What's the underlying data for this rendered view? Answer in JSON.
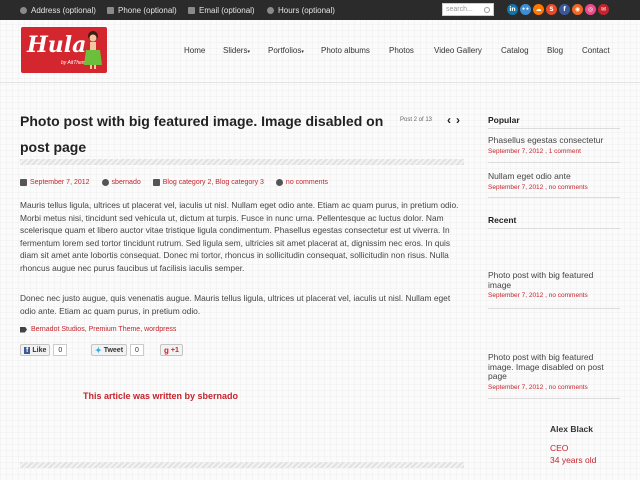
{
  "topbar": {
    "address": "Address (optional)",
    "phone": "Phone (optional)",
    "email": "Email (optional)",
    "hours": "Hours (optional)",
    "search_placeholder": "search...",
    "socials": [
      {
        "name": "linkedin-icon",
        "glyph": "in",
        "color": "#0e76a8"
      },
      {
        "name": "flickr-icon",
        "glyph": "••",
        "color": "#3a8fd8"
      },
      {
        "name": "soundcloud-icon",
        "glyph": "☁",
        "color": "#ff7700"
      },
      {
        "name": "stumbleupon-icon",
        "glyph": "S",
        "color": "#eb4924"
      },
      {
        "name": "facebook-icon",
        "glyph": "f",
        "color": "#3b5998"
      },
      {
        "name": "rss-icon",
        "glyph": "◉",
        "color": "#f26522"
      },
      {
        "name": "dribbble-icon",
        "glyph": "◎",
        "color": "#ea4c89"
      },
      {
        "name": "email-icon",
        "glyph": "✉",
        "color": "#c8232c"
      }
    ]
  },
  "logo": {
    "word": "Hula",
    "tagline": "by AitThemes"
  },
  "nav": {
    "home": "Home",
    "sliders": "Sliders",
    "portfolios": "Portfolios",
    "photo_albums": "Photo albums",
    "photos": "Photos",
    "video_gallery": "Video Gallery",
    "catalog": "Catalog",
    "blog": "Blog",
    "contact": "Contact"
  },
  "post": {
    "title": "Photo post with big featured image. Image disabled on post page",
    "count": "Post 2 of 13",
    "date": "September 7, 2012",
    "author": "sbernado",
    "categories": "Blog category 2, Blog category 3",
    "comments": "no comments",
    "paragraph1": "Mauris tellus ligula, ultrices ut placerat vel, iaculis ut nisl. Nullam eget odio ante. Etiam ac quam purus, in pretium odio. Morbi metus nisi, tincidunt sed vehicula ut, dictum at turpis. Fusce in nunc urna. Pellentesque ac luctus dolor. Nam scelerisque quam et libero auctor vitae tristique ligula condimentum. Phasellus egestas consectetur est ut viverra. In fermentum lorem sed tortor tincidunt rutrum. Sed ligula sem, ultricies sit amet placerat at, dignissim nec eros. In quis diam sit amet ante lobortis consequat. Donec mi tortor, rhoncus in sollicitudin consequat, sollicitudin non risus. Nulla rhoncus augue nec purus faucibus ut facilisis iaculis semper.",
    "paragraph2": "Donec nec justo augue, quis venenatis augue. Mauris tellus ligula, ultrices ut placerat vel, iaculis ut nisl. Nullam eget odio ante. Etiam ac quam purus, in pretium odio.",
    "tags": "Bernadot Studios, Premium Theme, wordpress",
    "share": {
      "like": "Like",
      "like_count": "0",
      "tweet": "Tweet",
      "tweet_count": "0",
      "plus": "+1"
    },
    "author_line": "This article was written by sbernado"
  },
  "sidebar": {
    "popular_title": "Popular",
    "popular": [
      {
        "title": "Phasellus egestas consectetur",
        "date": "September 7, 2012",
        "comments": "1 comment"
      },
      {
        "title": "Nullam eget odio ante",
        "date": "September 7, 2012",
        "comments": "no comments"
      }
    ],
    "recent_title": "Recent",
    "recent": [
      {
        "title": "Photo post with big featured image",
        "date": "September 7, 2012",
        "comments": "no comments"
      },
      {
        "title": "Photo post with big featured image. Image disabled on post page",
        "date": "September 7, 2012",
        "comments": "no comments"
      }
    ],
    "profile": {
      "name": "Alex Black",
      "role": "CEO",
      "age": "34 years old"
    }
  }
}
